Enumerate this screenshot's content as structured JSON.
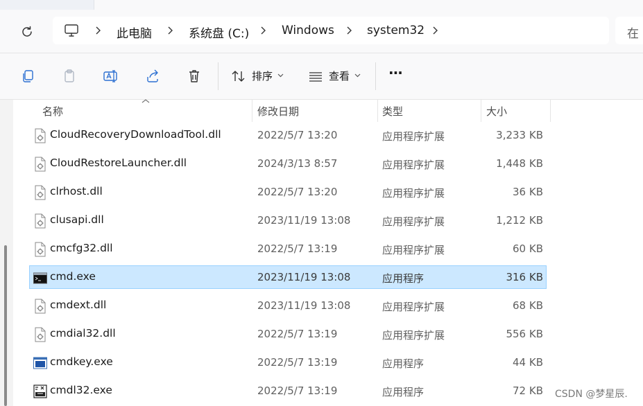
{
  "address": {
    "breadcrumbs": [
      "此电脑",
      "系统盘 (C:)",
      "Windows",
      "system32"
    ],
    "search_placeholder": "在"
  },
  "toolbar": {
    "sort_label": "排序",
    "view_label": "查看",
    "more_label": "···"
  },
  "columns": {
    "name": "名称",
    "date": "修改日期",
    "type": "类型",
    "size": "大小"
  },
  "files": [
    {
      "name": "CloudRecoveryDownloadTool.dll",
      "date": "2022/5/7 13:20",
      "type": "应用程序扩展",
      "size": "3,233 KB",
      "icon": "dll-file-icon"
    },
    {
      "name": "CloudRestoreLauncher.dll",
      "date": "2024/3/13 8:57",
      "type": "应用程序扩展",
      "size": "1,448 KB",
      "icon": "dll-file-icon"
    },
    {
      "name": "clrhost.dll",
      "date": "2022/5/7 13:20",
      "type": "应用程序扩展",
      "size": "36 KB",
      "icon": "dll-file-icon"
    },
    {
      "name": "clusapi.dll",
      "date": "2023/11/19 13:08",
      "type": "应用程序扩展",
      "size": "1,212 KB",
      "icon": "dll-file-icon"
    },
    {
      "name": "cmcfg32.dll",
      "date": "2022/5/7 13:19",
      "type": "应用程序扩展",
      "size": "60 KB",
      "icon": "dll-file-icon"
    },
    {
      "name": "cmd.exe",
      "date": "2023/11/19 13:08",
      "type": "应用程序",
      "size": "316 KB",
      "icon": "cmd-exe-icon"
    },
    {
      "name": "cmdext.dll",
      "date": "2023/11/19 13:08",
      "type": "应用程序扩展",
      "size": "68 KB",
      "icon": "dll-file-icon"
    },
    {
      "name": "cmdial32.dll",
      "date": "2022/5/7 13:19",
      "type": "应用程序扩展",
      "size": "556 KB",
      "icon": "dll-file-icon"
    },
    {
      "name": "cmdkey.exe",
      "date": "2022/5/7 13:19",
      "type": "应用程序",
      "size": "44 KB",
      "icon": "app-window-icon"
    },
    {
      "name": "cmdl32.exe",
      "date": "2022/5/7 13:19",
      "type": "应用程序",
      "size": "72 KB",
      "icon": "cmdl32-exe-icon"
    }
  ],
  "selected_file": "cmd.exe",
  "watermark": "CSDN @梦星辰.",
  "colors": {
    "selection_bg": "#cce8ff",
    "selection_border": "#99d1ff",
    "chrome_bg": "#f9f9fa"
  }
}
